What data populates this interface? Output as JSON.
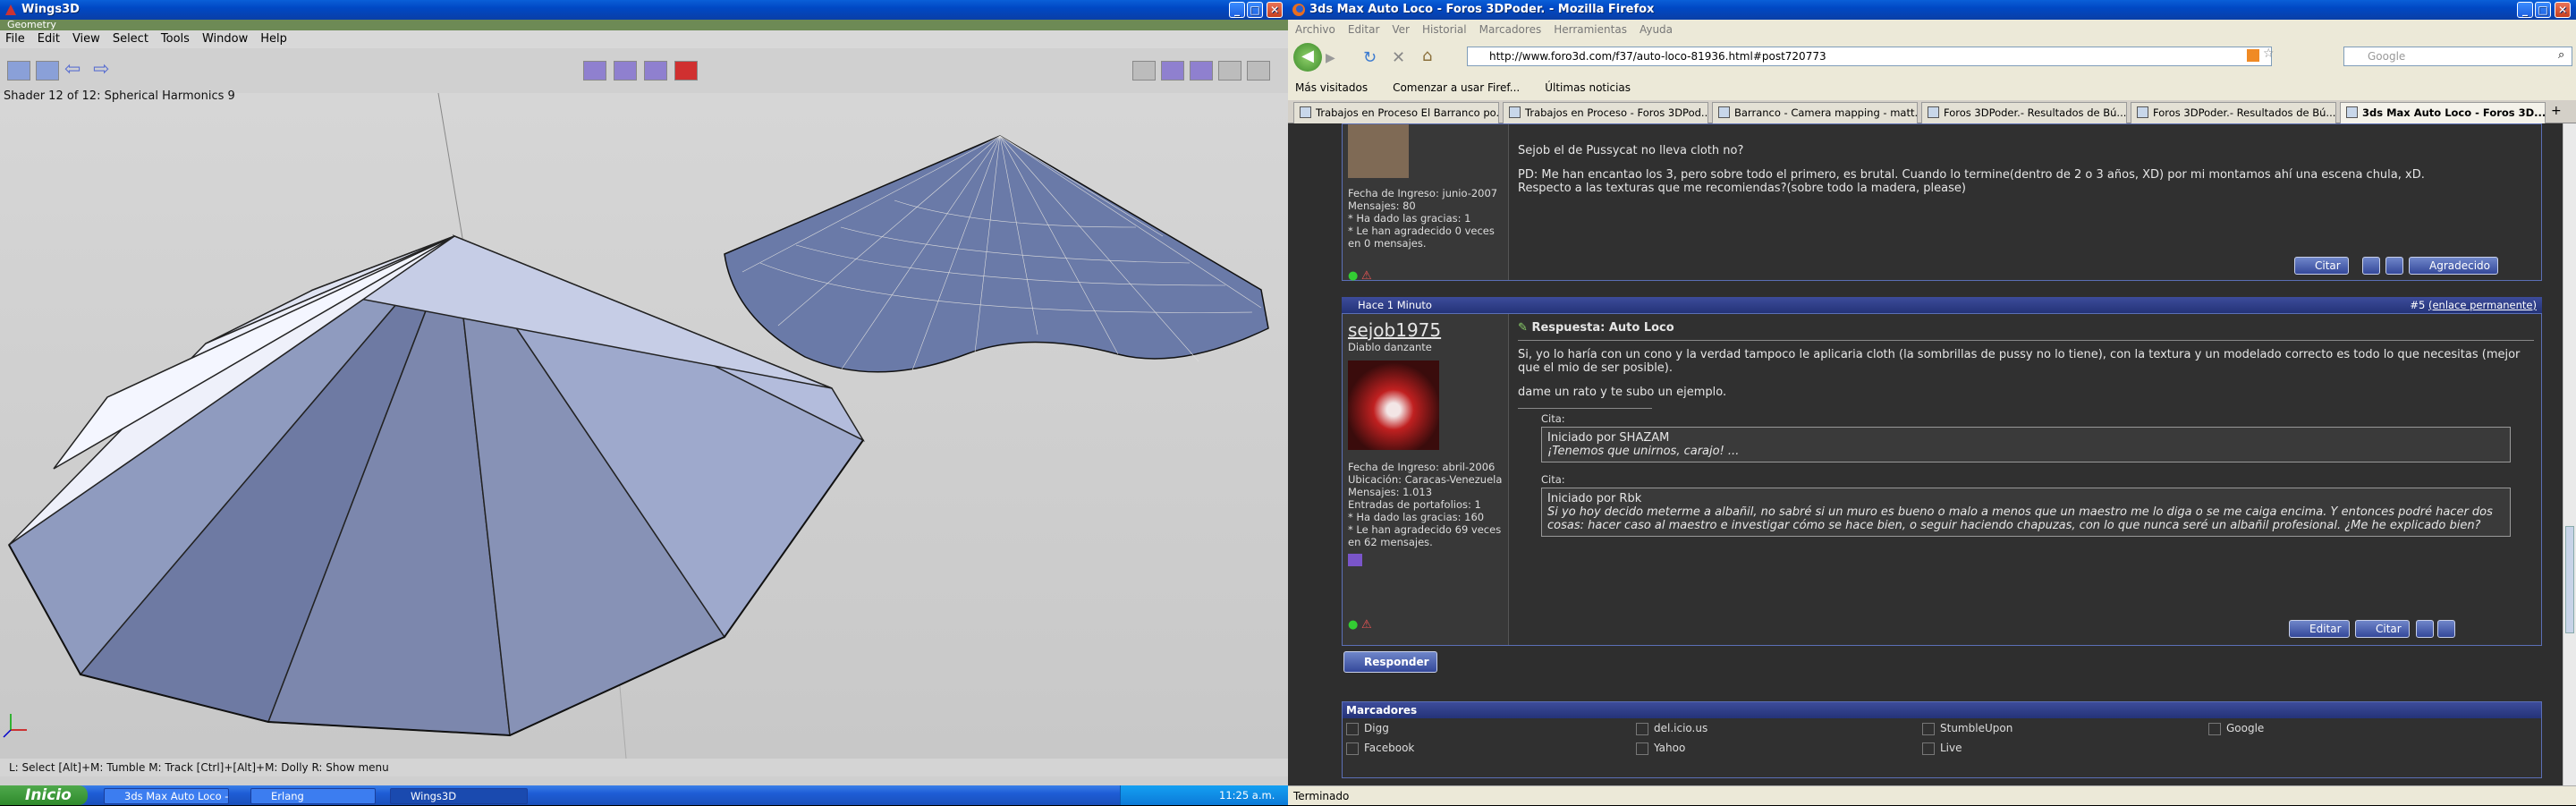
{
  "wings": {
    "title": "Wings3D",
    "geometry_label": "Geometry",
    "menu": [
      "File",
      "Edit",
      "View",
      "Select",
      "Tools",
      "Window",
      "Help"
    ],
    "shader_info": "Shader 12 of 12: Spherical Harmonics 9",
    "status": "L: Select   [Alt]+M: Tumble   M: Track   [Ctrl]+[Alt]+M: Dolly   R: Show menu"
  },
  "firefox": {
    "title": "3ds Max Auto Loco - Foros 3DPoder. - Mozilla Firefox",
    "menu": [
      "Archivo",
      "Editar",
      "Ver",
      "Historial",
      "Marcadores",
      "Herramientas",
      "Ayuda"
    ],
    "url": "http://www.foro3d.com/f37/auto-loco-81936.html#post720773",
    "search_placeholder": "Google",
    "bookmarks": [
      "Más visitados",
      "Comenzar a usar Firef...",
      "Últimas noticias"
    ],
    "tabs": [
      "Trabajos en Proceso El Barranco po...",
      "Trabajos en Proceso - Foros 3DPod...",
      "Barranco - Camera mapping - matt...",
      "Foros 3DPoder.- Resultados de Bú...",
      "Foros 3DPoder.- Resultados de Bú...",
      "3ds Max Auto Loco - Foros 3D..."
    ],
    "status": "Terminado"
  },
  "post1": {
    "user_info": [
      "Fecha de Ingreso: junio-2007",
      "Mensajes: 80",
      "* Ha dado las gracias: 1",
      "* Le han agradecido 0 veces",
      "en 0 mensajes."
    ],
    "line1": "Sejob el de Pussycat no lleva cloth no?",
    "line2": "PD: Me han encantao los 3, pero sobre todo el primero, es brutal. Cuando lo termine(dentro de 2 o 3 años, XD) por mi montamos ahí una escena chula, xD.",
    "line3": "Respecto a las texturas que me recomiendas?(sobre todo la madera, please)",
    "btn_cite": "Citar",
    "btn_thanks": "Agradecido"
  },
  "post2": {
    "time": "Hace 1 Minuto",
    "permalink_num": "#5",
    "permalink": "(enlace permanente)",
    "username": "sejob1975",
    "usertitle": "Diablo danzante",
    "user_info": [
      "Fecha de Ingreso: abril-2006",
      "Ubicación: Caracas-Venezuela",
      "Mensajes: 1.013",
      "Entradas de portafolios: 1",
      "* Ha dado las gracias: 160",
      "* Le han agradecido 69 veces",
      "en 62 mensajes."
    ],
    "subject": "Respuesta: Auto Loco",
    "body1": "Si, yo lo haría con un cono y la verdad tampoco le aplicaria cloth (la sombrillas de pussy no lo tiene), con la textura y un modelado correcto es todo lo que necesitas (mejor que el mio de ser posible).",
    "body2": "dame un rato y te subo un ejemplo.",
    "quote_label": "Cita:",
    "q1_by": "Iniciado por SHAZAM",
    "q1_text": "¡Tenemos que unirnos, carajo! ...",
    "q2_by": "Iniciado por Rbk",
    "q2_text": "Si yo hoy decido meterme a albañil, no sabré si un muro es bueno o malo a menos que un maestro me lo diga o se me caiga encima. Y entonces podré hacer dos cosas: hacer caso al maestro e investigar cómo se hace bien, o seguir haciendo chapuzas, con lo que nunca seré un albañil profesional. ¿Me he explicado bien?",
    "btn_edit": "Editar",
    "btn_cite": "Citar"
  },
  "reply_button": "Responder",
  "markers": {
    "title": "Marcadores",
    "items": [
      "Digg",
      "del.icio.us",
      "StumbleUpon",
      "Google",
      "Facebook",
      "Yahoo",
      "Live"
    ]
  },
  "taskbar": {
    "start": "Inicio",
    "tasks": [
      "3ds Max Auto Loco - ...",
      "Erlang",
      "Wings3D"
    ],
    "clock": "11:25 a.m."
  }
}
